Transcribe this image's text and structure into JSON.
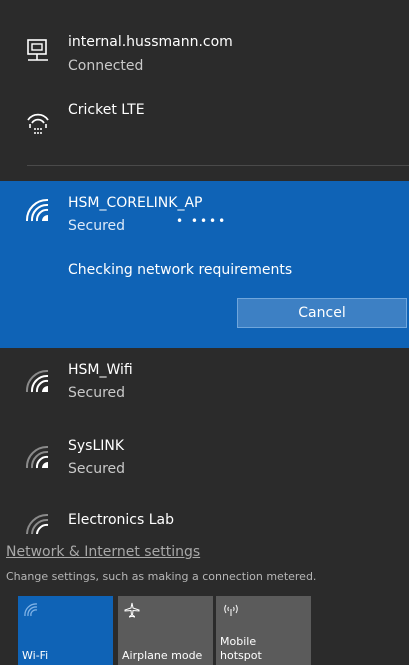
{
  "networks": {
    "wired": {
      "name": "internal.hussmann.com",
      "status": "Connected"
    },
    "cellular": {
      "name": "Cricket LTE"
    },
    "selected": {
      "name": "HSM_CORELINK_AP",
      "status": "Secured",
      "progress": "• ••••",
      "message": "Checking network requirements",
      "cancel_label": "Cancel"
    },
    "wifi1": {
      "name": "HSM_Wifi",
      "status": "Secured"
    },
    "wifi2": {
      "name": "SysLINK",
      "status": "Secured"
    },
    "wifi3": {
      "name": "Electronics Lab"
    }
  },
  "settings": {
    "link_text": "Network & Internet settings",
    "description": "Change settings, such as making a connection metered."
  },
  "quick_actions": {
    "wifi": {
      "label": "Wi-Fi",
      "icon": "wifi-icon",
      "active": true
    },
    "airplane": {
      "label": "Airplane mode",
      "icon": "airplane-icon",
      "active": false
    },
    "hotspot": {
      "label_line1": "Mobile",
      "label_line2": "hotspot",
      "icon": "hotspot-icon",
      "active": false
    }
  },
  "colors": {
    "accent": "#0f63b6",
    "background": "#2b2b2b",
    "tile_inactive": "#5b5b5b"
  }
}
